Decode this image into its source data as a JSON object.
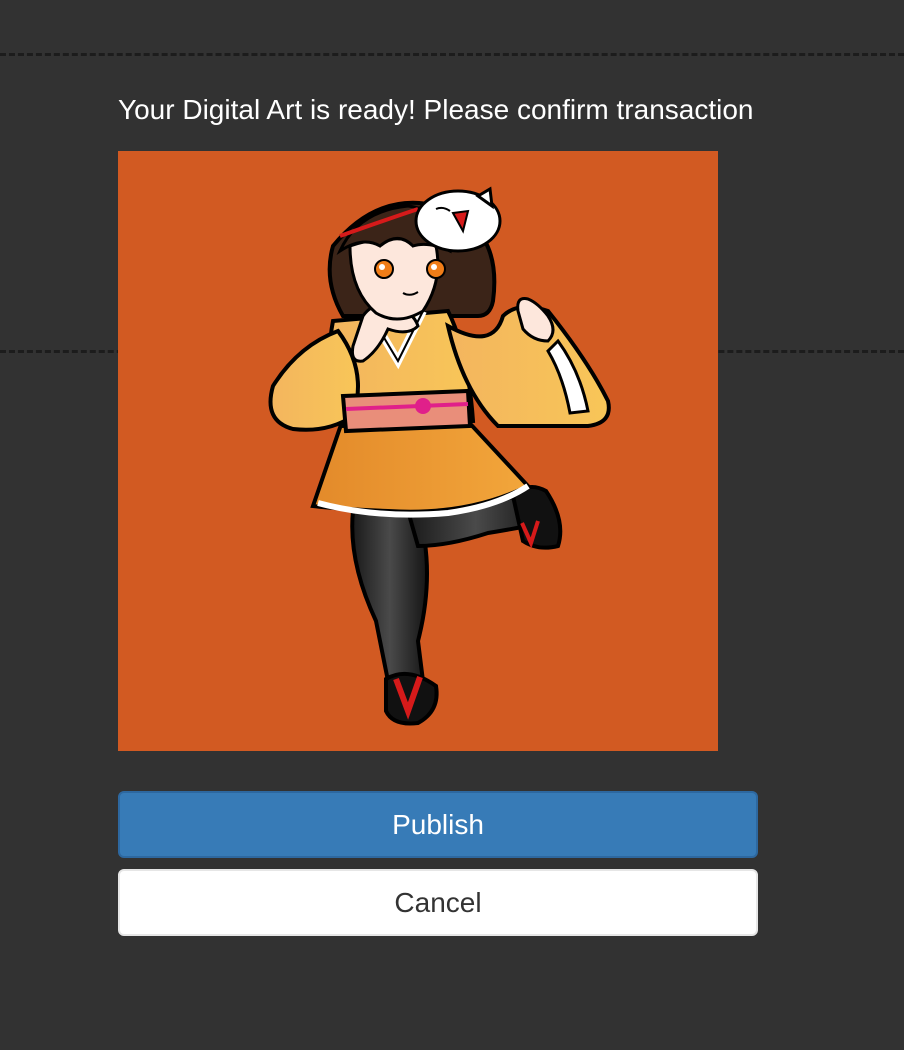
{
  "dialog": {
    "title": "Your Digital Art is ready! Please confirm transaction",
    "artwork": {
      "background_color": "#d25a22",
      "subject": "anime-girl-in-yellow-kimono-with-cat-mask"
    },
    "publish_label": "Publish",
    "cancel_label": "Cancel"
  },
  "colors": {
    "page_background": "#323232",
    "publish_button": "#377bb7",
    "cancel_button": "#ffffff"
  }
}
